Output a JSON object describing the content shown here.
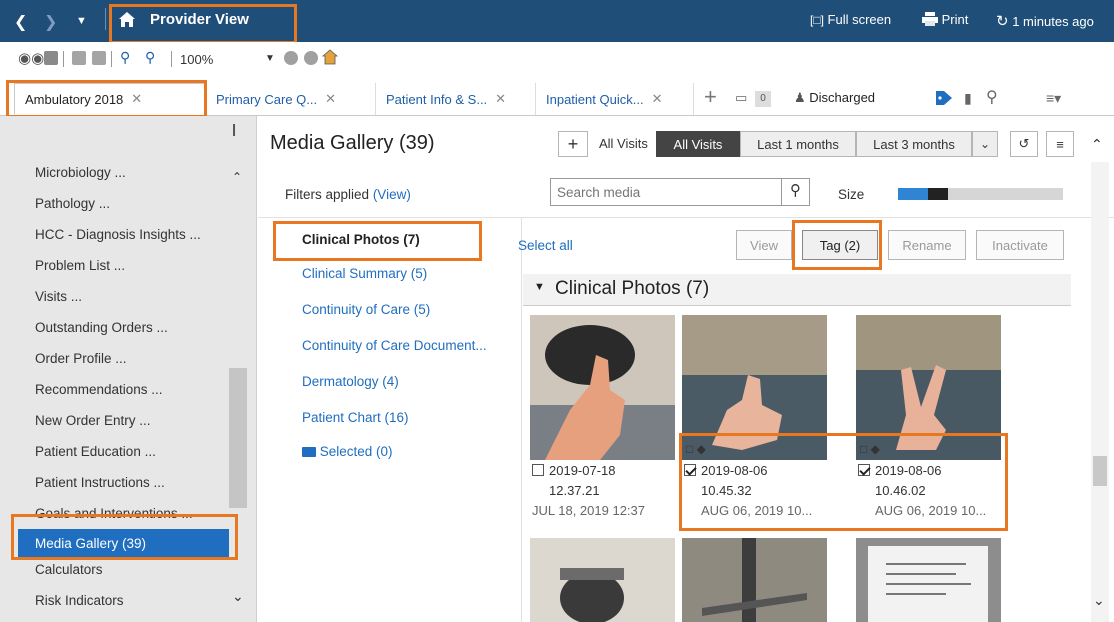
{
  "topbar": {
    "title": "Provider View",
    "fullscreen_label": "Full screen",
    "print_label": "Print",
    "refresh_label": "1 minutes ago"
  },
  "toolbar": {
    "zoom": "100%"
  },
  "tabs": [
    {
      "label": "Ambulatory 2018"
    },
    {
      "label": "Primary Care Q..."
    },
    {
      "label": "Patient Info & S..."
    },
    {
      "label": "Inpatient Quick..."
    }
  ],
  "tabstrip": {
    "count_badge": "0",
    "discharged_label": "Discharged"
  },
  "sidebar": {
    "items": [
      "Microbiology ...",
      "Pathology ...",
      "HCC - Diagnosis Insights ...",
      "Problem List ...",
      "Visits ...",
      "Outstanding Orders ...",
      "Order Profile ...",
      "Recommendations ...",
      "New Order Entry ...",
      "Patient Education ...",
      "Patient Instructions ...",
      "Goals and Interventions ...",
      "Media Gallery (39)",
      "Calculators",
      "Risk Indicators"
    ]
  },
  "gallery": {
    "title": "Media Gallery",
    "count": "(39)",
    "visits_label": "All Visits",
    "visit_filters": [
      "All Visits",
      "Last 1 months",
      "Last 3 months"
    ],
    "filters_label": "Filters applied",
    "filters_link": "(View)",
    "search_placeholder": "Search media",
    "size_label": "Size",
    "categories": [
      "Clinical Photos (7)",
      "Clinical Summary (5)",
      "Continuity of Care (5)",
      "Continuity of Care Document...",
      "Dermatology (4)",
      "Patient Chart (16)",
      "Selected (0)"
    ],
    "select_all": "Select all",
    "actions": {
      "view": "View",
      "tag": "Tag (2)",
      "rename": "Rename",
      "inactivate": "Inactivate"
    },
    "section_title": "Clinical Photos (7)",
    "photos": [
      {
        "date": "2019-07-18",
        "time": "12.37.21",
        "sub": "JUL 18, 2019 12:37",
        "checked": false
      },
      {
        "date": "2019-08-06",
        "time": "10.45.32",
        "sub": "AUG 06, 2019 10...",
        "checked": true
      },
      {
        "date": "2019-08-06",
        "time": "10.46.02",
        "sub": "AUG 06, 2019 10...",
        "checked": true
      }
    ]
  }
}
